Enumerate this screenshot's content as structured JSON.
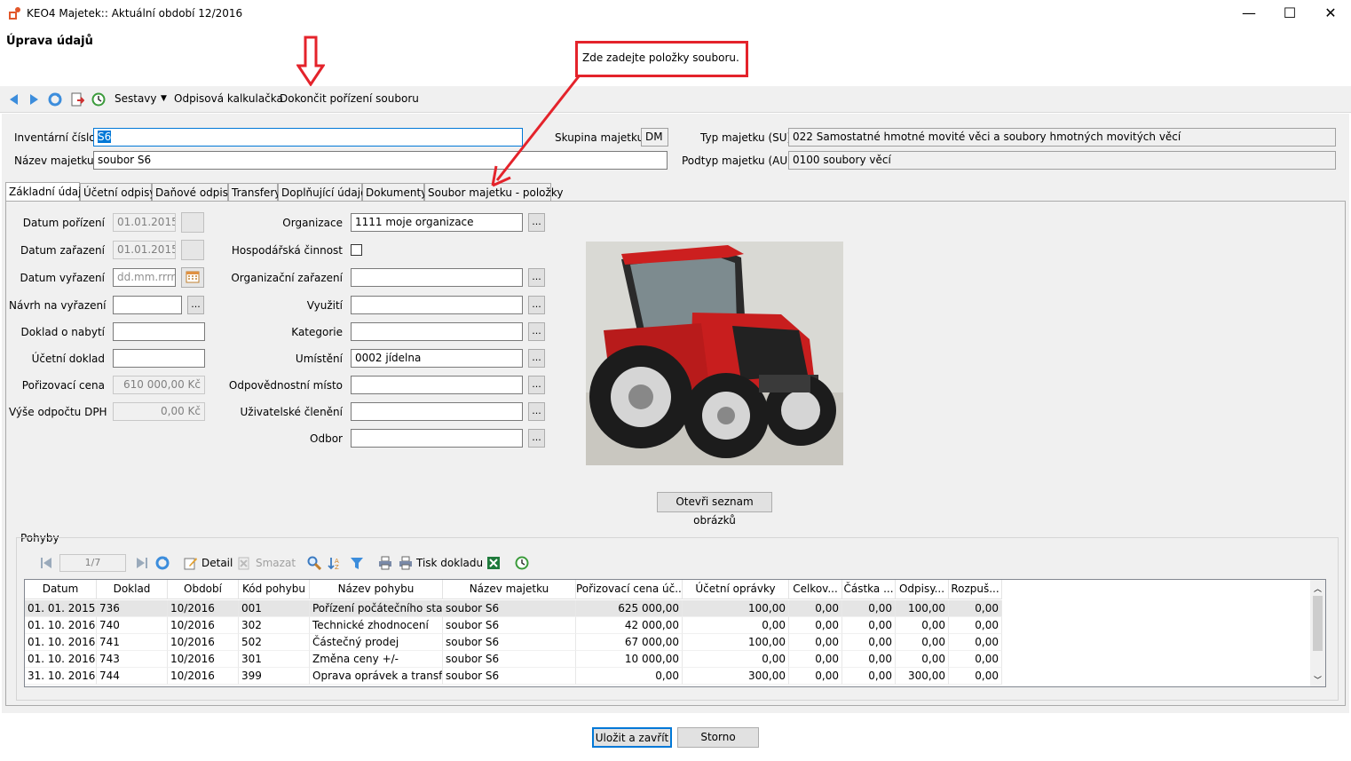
{
  "window": {
    "title": "KEO4 Majetek:: Aktuální období 12/2016",
    "minimize": "—",
    "maximize": "☐",
    "close": "✕"
  },
  "header": {
    "title": "Úprava údajů"
  },
  "toolbar": {
    "reports": "Sestavy",
    "calc": "Odpisová kalkulačka",
    "finish": "Dokončit pořízení souboru"
  },
  "callout": {
    "text": "Zde zadejte položky souboru."
  },
  "top_form": {
    "inv_label": "Inventární číslo",
    "inv_value": "S6",
    "name_label": "Název majetku",
    "name_value": "soubor S6",
    "group_label": "Skupina majetku",
    "group_value": "DM",
    "type_label": "Typ majetku (SU)",
    "type_value": "022 Samostatné hmotné movité věci a soubory hmotných movitých věcí",
    "subtype_label": "Podtyp majetku (AU)",
    "subtype_value": "0100 soubory věcí"
  },
  "tabs": [
    "Základní údaje",
    "Účetní odpisy",
    "Daňové odpisy",
    "Transfery",
    "Doplňující údaje",
    "Dokumenty",
    "Soubor majetku - položky"
  ],
  "basic": {
    "date_acq_label": "Datum pořízení",
    "date_acq": "01.01.2015",
    "date_inc_label": "Datum zařazení",
    "date_inc": "01.01.2015",
    "date_disp_label": "Datum vyřazení",
    "date_disp_placeholder": "dd.mm.rrrr",
    "proposal_label": "Návrh na vyřazení",
    "acq_doc_label": "Doklad o nabytí",
    "acc_doc_label": "Účetní doklad",
    "cost_label": "Pořizovací cena",
    "cost": "610 000,00 Kč",
    "vat_label": "Výše odpočtu DPH",
    "vat": "0,00 Kč",
    "org_label": "Organizace",
    "org": "1111 moje organizace",
    "econ_label": "Hospodářská činnost",
    "orgassign_label": "Organizační zařazení",
    "usage_label": "Využití",
    "category_label": "Kategorie",
    "location_label": "Umístění",
    "location": "0002 jídelna",
    "resp_label": "Odpovědnostní místo",
    "user_label": "Uživatelské členění",
    "dept_label": "Odbor",
    "dots": "...",
    "open_images": "Otevři seznam obrázků"
  },
  "movements": {
    "title": "Pohyby",
    "pager": "1/7",
    "detail": "Detail",
    "delete": "Smazat",
    "print_doc": "Tisk dokladu",
    "columns": [
      "Datum",
      "Doklad",
      "Období",
      "Kód pohybu",
      "Název pohybu",
      "Název majetku",
      "Pořizovací cena úč...",
      "Účetní oprávky",
      "Celkov...",
      "Částka ...",
      "Odpisy...",
      "Rozpuš..."
    ],
    "rows": [
      [
        "01. 01. 2015",
        "736",
        "10/2016",
        "001",
        "Pořízení počátečního stavu",
        "soubor S6",
        "625 000,00",
        "100,00",
        "0,00",
        "0,00",
        "100,00",
        "0,00"
      ],
      [
        "01. 10. 2016",
        "740",
        "10/2016",
        "302",
        "Technické zhodnocení",
        "soubor S6",
        "42 000,00",
        "0,00",
        "0,00",
        "0,00",
        "0,00",
        "0,00"
      ],
      [
        "01. 10. 2016",
        "741",
        "10/2016",
        "502",
        "Částečný prodej",
        "soubor S6",
        "67 000,00",
        "100,00",
        "0,00",
        "0,00",
        "0,00",
        "0,00"
      ],
      [
        "01. 10. 2016",
        "743",
        "10/2016",
        "301",
        "Změna ceny +/-",
        "soubor S6",
        "10 000,00",
        "0,00",
        "0,00",
        "0,00",
        "0,00",
        "0,00"
      ],
      [
        "31. 10. 2016",
        "744",
        "10/2016",
        "399",
        "Oprava oprávek a transferů",
        "soubor S6",
        "0,00",
        "300,00",
        "0,00",
        "0,00",
        "300,00",
        "0,00"
      ]
    ]
  },
  "footer": {
    "save": "Uložit a zavřít",
    "cancel": "Storno"
  },
  "colors": {
    "accent": "#0078d7",
    "callout": "#e4232b",
    "selected_row": "#e5e5e5"
  }
}
